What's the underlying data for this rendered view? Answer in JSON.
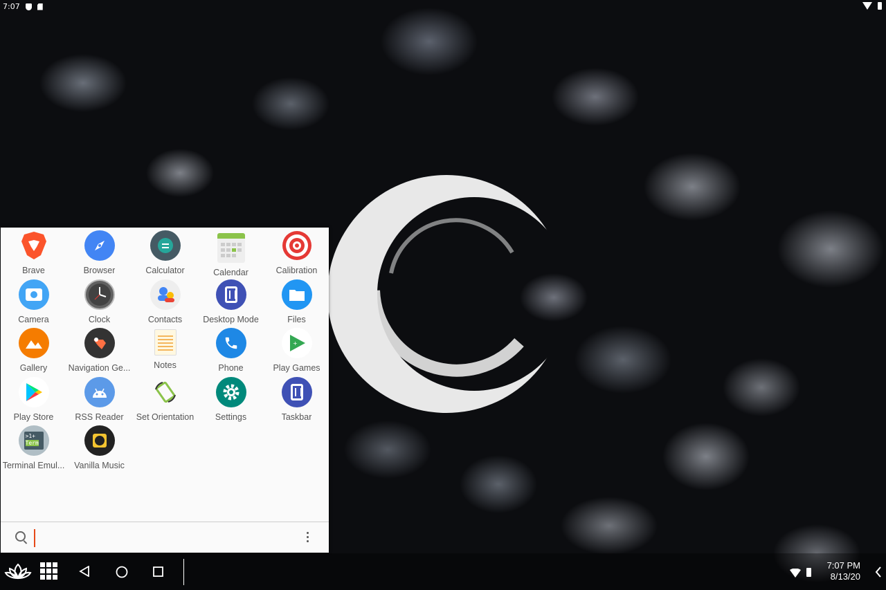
{
  "status_bar": {
    "time": "7:07"
  },
  "drawer": {
    "apps": [
      {
        "label": "Brave",
        "icon": "brave-icon"
      },
      {
        "label": "Browser",
        "icon": "browser-icon"
      },
      {
        "label": "Calculator",
        "icon": "calculator-icon"
      },
      {
        "label": "Calendar",
        "icon": "calendar-icon"
      },
      {
        "label": "Calibration",
        "icon": "calibration-icon"
      },
      {
        "label": "Camera",
        "icon": "camera-icon"
      },
      {
        "label": "Clock",
        "icon": "clock-icon"
      },
      {
        "label": "Contacts",
        "icon": "contacts-icon"
      },
      {
        "label": "Desktop Mode",
        "icon": "desktop-mode-icon"
      },
      {
        "label": "Files",
        "icon": "files-icon"
      },
      {
        "label": "Gallery",
        "icon": "gallery-icon"
      },
      {
        "label": "Navigation Ge...",
        "icon": "navigation-gestures-icon"
      },
      {
        "label": "Notes",
        "icon": "notes-icon"
      },
      {
        "label": "Phone",
        "icon": "phone-icon"
      },
      {
        "label": "Play Games",
        "icon": "play-games-icon"
      },
      {
        "label": "Play Store",
        "icon": "play-store-icon"
      },
      {
        "label": "RSS Reader",
        "icon": "rss-reader-icon"
      },
      {
        "label": "Set Orientation",
        "icon": "set-orientation-icon"
      },
      {
        "label": "Settings",
        "icon": "settings-icon"
      },
      {
        "label": "Taskbar",
        "icon": "taskbar-icon"
      },
      {
        "label": "Terminal Emul...",
        "icon": "terminal-emulator-icon"
      },
      {
        "label": "Vanilla Music",
        "icon": "vanilla-music-icon"
      }
    ],
    "search": {
      "value": "",
      "placeholder": ""
    }
  },
  "taskbar": {
    "time": "7:07 PM",
    "date": "8/13/20"
  },
  "colors": {
    "drawer_bg": "#fafafa",
    "cursor": "#e64a19"
  }
}
